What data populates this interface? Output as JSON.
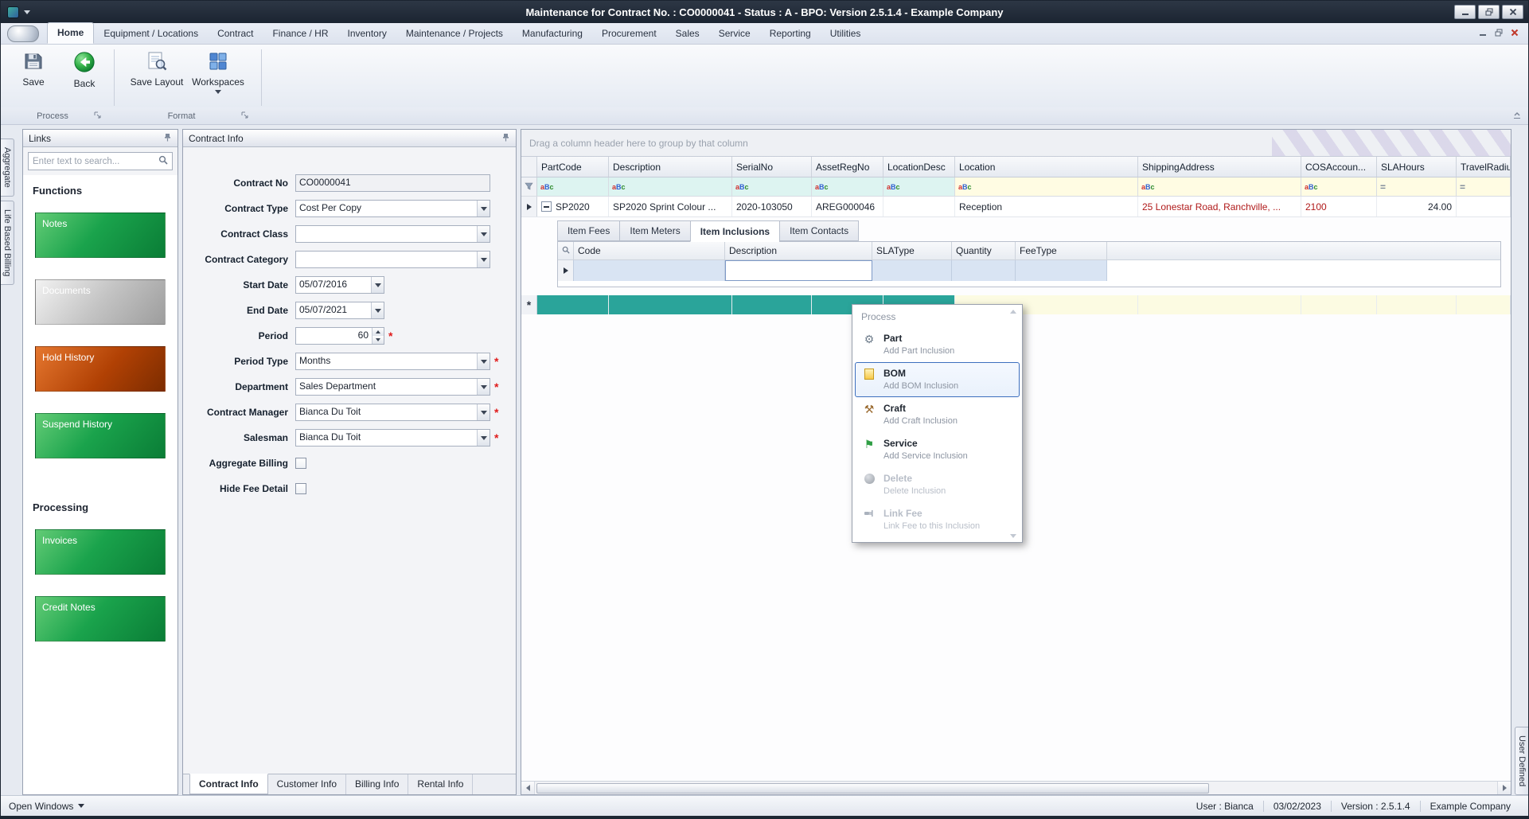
{
  "titlebar": {
    "title": "Maintenance for Contract No. : CO0000041 - Status : A - BPO: Version 2.5.1.4 - Example Company"
  },
  "ribbon": {
    "tabs": [
      "Home",
      "Equipment / Locations",
      "Contract",
      "Finance / HR",
      "Inventory",
      "Maintenance / Projects",
      "Manufacturing",
      "Procurement",
      "Sales",
      "Service",
      "Reporting",
      "Utilities"
    ],
    "active_tab": "Home",
    "buttons": {
      "save": "Save",
      "back": "Back",
      "save_layout": "Save Layout",
      "workspaces": "Workspaces"
    },
    "groups": [
      "Process",
      "Format"
    ]
  },
  "edge_tabs": {
    "left": [
      "Aggregate",
      "Life Based Billing"
    ],
    "right": [
      "User Defined"
    ]
  },
  "links_panel": {
    "title": "Links",
    "search_placeholder": "Enter text to search...",
    "functions_heading": "Functions",
    "processing_heading": "Processing",
    "function_buttons": [
      {
        "label": "Notes"
      },
      {
        "label": "Documents"
      },
      {
        "label": "Hold History"
      },
      {
        "label": "Suspend History"
      }
    ],
    "processing_buttons": [
      {
        "label": "Invoices"
      },
      {
        "label": "Credit Notes"
      }
    ]
  },
  "contract_panel": {
    "title": "Contract Info",
    "fields": [
      {
        "label": "Contract No",
        "value": "CO0000041"
      },
      {
        "label": "Contract Type",
        "value": "Cost Per Copy"
      },
      {
        "label": "Contract Class",
        "value": ""
      },
      {
        "label": "Contract Category",
        "value": ""
      },
      {
        "label": "Start Date",
        "value": "05/07/2016"
      },
      {
        "label": "End Date",
        "value": "05/07/2021"
      },
      {
        "label": "Period",
        "value": "60"
      },
      {
        "label": "Period Type",
        "value": "Months"
      },
      {
        "label": "Department",
        "value": "Sales Department"
      },
      {
        "label": "Contract Manager",
        "value": "Bianca Du Toit"
      },
      {
        "label": "Salesman",
        "value": "Bianca Du Toit"
      },
      {
        "label": "Aggregate Billing"
      },
      {
        "label": "Hide Fee Detail"
      }
    ],
    "tabs": [
      "Contract Info",
      "Customer Info",
      "Billing Info",
      "Rental Info"
    ],
    "active_tab": "Contract Info"
  },
  "grid": {
    "group_hint": "Drag a column header here to group by that column",
    "columns": [
      "PartCode",
      "Description",
      "SerialNo",
      "AssetRegNo",
      "LocationDesc",
      "Location",
      "ShippingAddress",
      "COSAccoun...",
      "SLAHours",
      "TravelRadiu..."
    ],
    "filter": {
      "a": "a",
      "b": "B",
      "c": "c",
      "equals": "="
    },
    "row": {
      "part_code": "SP2020",
      "description": "SP2020 Sprint Colour ...",
      "serial_no": "2020-103050",
      "asset_reg_no": "AREG000046",
      "location_desc": "",
      "location": "Reception",
      "shipping_address": "25 Lonestar Road, Ranchville, ...",
      "cos_account": "2100",
      "sla_hours": "24.00",
      "travel_radius": ""
    },
    "detail_tabs": [
      "Item Fees",
      "Item Meters",
      "Item Inclusions",
      "Item Contacts"
    ],
    "active_detail_tab": "Item Inclusions",
    "detail_columns": [
      "Code",
      "Description",
      "SLAType",
      "Quantity",
      "FeeType"
    ]
  },
  "context_menu": {
    "header": "Process",
    "items": [
      {
        "title": "Part",
        "subtitle": "Add Part Inclusion",
        "enabled": true
      },
      {
        "title": "BOM",
        "subtitle": "Add BOM Inclusion",
        "enabled": true,
        "selected": true
      },
      {
        "title": "Craft",
        "subtitle": "Add Craft Inclusion",
        "enabled": true
      },
      {
        "title": "Service",
        "subtitle": "Add Service Inclusion",
        "enabled": true
      },
      {
        "title": "Delete",
        "subtitle": "Delete Inclusion",
        "enabled": false
      },
      {
        "title": "Link Fee",
        "subtitle": "Link Fee to this Inclusion",
        "enabled": false
      }
    ]
  },
  "statusbar": {
    "open_windows": "Open Windows",
    "user": "User : Bianca",
    "date": "03/02/2023",
    "version": "Version : 2.5.1.4",
    "company": "Example Company"
  },
  "colors": {
    "function_button_green": "#1aa34c",
    "hold_history_orange": "#b14104",
    "teal_row": "#2aa49a",
    "required_red": "#e01b1b",
    "grid_red_text": "#b01a1a",
    "selection_blue": "#3d6fbe"
  }
}
